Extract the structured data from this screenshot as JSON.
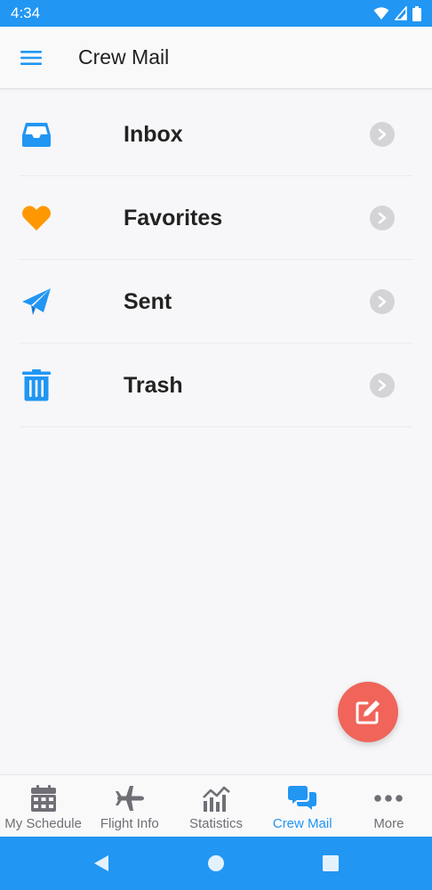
{
  "status_bar": {
    "time": "4:34",
    "icons": [
      "wifi-icon",
      "signal-icon",
      "battery-icon"
    ]
  },
  "app_bar": {
    "title": "Crew Mail",
    "menu_icon": "hamburger-menu-icon"
  },
  "mail_folders": [
    {
      "label": "Inbox",
      "icon": "inbox-tray-icon",
      "color": "#2196f3"
    },
    {
      "label": "Favorites",
      "icon": "heart-icon",
      "color": "#ff9800"
    },
    {
      "label": "Sent",
      "icon": "paper-plane-icon",
      "color": "#2196f3"
    },
    {
      "label": "Trash",
      "icon": "trash-can-icon",
      "color": "#2196f3"
    }
  ],
  "compose_button": {
    "icon": "compose-edit-icon",
    "color": "#f0645a"
  },
  "tabs": [
    {
      "label": "My Schedule",
      "icon": "calendar-icon",
      "active": false
    },
    {
      "label": "Flight Info",
      "icon": "airplane-icon",
      "active": false
    },
    {
      "label": "Statistics",
      "icon": "chart-icon",
      "active": false
    },
    {
      "label": "Crew Mail",
      "icon": "chat-bubbles-icon",
      "active": true
    },
    {
      "label": "More",
      "icon": "more-dots-icon",
      "active": false
    }
  ],
  "colors": {
    "accent": "#2196f3",
    "inactive": "#6f6f75",
    "favorite": "#ff9800"
  }
}
